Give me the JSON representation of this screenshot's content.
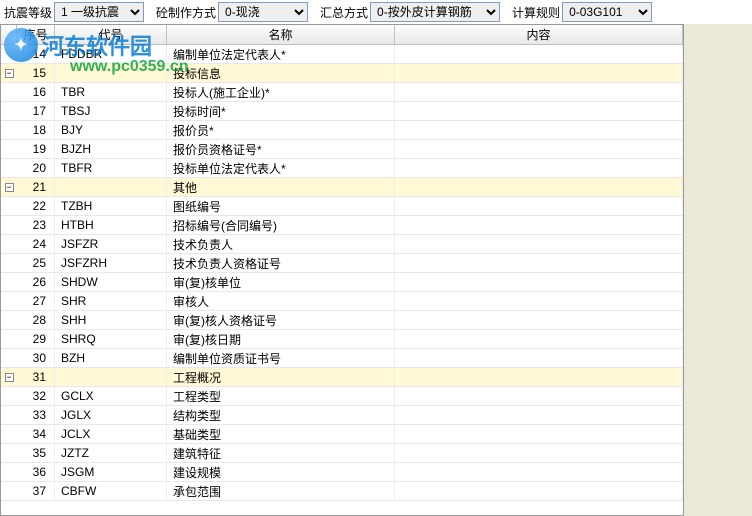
{
  "toolbar": {
    "seismic_label": "抗震等级",
    "seismic_value": "1 一级抗震",
    "control_label": "砼制作方式",
    "control_value": "0-现浇",
    "summary_label": "汇总方式",
    "summary_value": "0-按外皮计算钢筋",
    "rule_label": "计算规则",
    "rule_value": "0-03G101"
  },
  "headers": {
    "seq": "序号",
    "code": "代号",
    "name": "名称",
    "content": "内容"
  },
  "rows": [
    {
      "seq": "14",
      "code": "FDDBR",
      "name": "编制单位法定代表人*",
      "group": false
    },
    {
      "seq": "15",
      "code": "",
      "name": "投标信息",
      "group": true
    },
    {
      "seq": "16",
      "code": "TBR",
      "name": "投标人(施工企业)*",
      "group": false
    },
    {
      "seq": "17",
      "code": "TBSJ",
      "name": "投标时间*",
      "group": false
    },
    {
      "seq": "18",
      "code": "BJY",
      "name": "报价员*",
      "group": false
    },
    {
      "seq": "19",
      "code": "BJZH",
      "name": "报价员资格证号*",
      "group": false
    },
    {
      "seq": "20",
      "code": "TBFR",
      "name": "投标单位法定代表人*",
      "group": false
    },
    {
      "seq": "21",
      "code": "",
      "name": "其他",
      "group": true
    },
    {
      "seq": "22",
      "code": "TZBH",
      "name": "图纸编号",
      "group": false
    },
    {
      "seq": "23",
      "code": "HTBH",
      "name": "招标编号(合同编号)",
      "group": false
    },
    {
      "seq": "24",
      "code": "JSFZR",
      "name": "技术负责人",
      "group": false
    },
    {
      "seq": "25",
      "code": "JSFZRH",
      "name": "技术负责人资格证号",
      "group": false
    },
    {
      "seq": "26",
      "code": "SHDW",
      "name": "审(复)核单位",
      "group": false
    },
    {
      "seq": "27",
      "code": "SHR",
      "name": "审核人",
      "group": false
    },
    {
      "seq": "28",
      "code": "SHH",
      "name": "审(复)核人资格证号",
      "group": false
    },
    {
      "seq": "29",
      "code": "SHRQ",
      "name": "审(复)核日期",
      "group": false
    },
    {
      "seq": "30",
      "code": "BZH",
      "name": "编制单位资质证书号",
      "group": false
    },
    {
      "seq": "31",
      "code": "",
      "name": "工程概况",
      "group": true
    },
    {
      "seq": "32",
      "code": "GCLX",
      "name": "工程类型",
      "group": false
    },
    {
      "seq": "33",
      "code": "JGLX",
      "name": "结构类型",
      "group": false
    },
    {
      "seq": "34",
      "code": "JCLX",
      "name": "基础类型",
      "group": false
    },
    {
      "seq": "35",
      "code": "JZTZ",
      "name": "建筑特征",
      "group": false
    },
    {
      "seq": "36",
      "code": "JSGM",
      "name": "建设规模",
      "group": false
    },
    {
      "seq": "37",
      "code": "CBFW",
      "name": "承包范围",
      "group": false
    }
  ],
  "watermark": {
    "text": "河东软件园",
    "url": "www.pc0359.cn"
  },
  "expand_symbol": "−"
}
